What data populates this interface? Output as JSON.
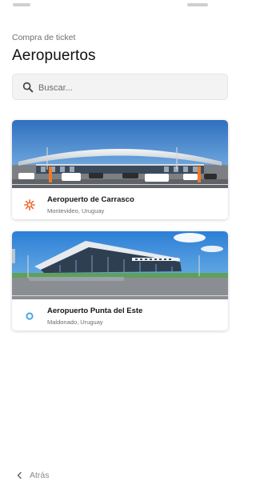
{
  "header": {
    "subtitle": "Compra de ticket",
    "title": "Aeropuertos"
  },
  "search": {
    "placeholder": "Buscar...",
    "icon": "search-icon"
  },
  "airports": [
    {
      "name": "Aeropuerto de Carrasco",
      "location": "Montevideo, Uruguay",
      "logo_icon": "sun-logo-icon",
      "logo_color": "#f0692a"
    },
    {
      "name": "Aeropuerto Punta del Este",
      "location": "Maldonado, Uruguay",
      "logo_icon": "circle-logo-icon",
      "logo_color": "#47a9e0"
    }
  ],
  "footer": {
    "back_label": "Atrás",
    "back_icon": "chevron-left-icon"
  }
}
